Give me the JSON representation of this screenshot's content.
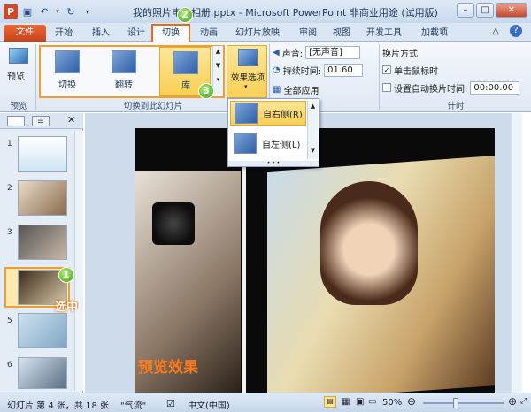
{
  "window": {
    "title": "我的照片电子相册.pptx - Microsoft PowerPoint 非商业用途 (试用版)",
    "controls": [
      "–",
      "□",
      "✕"
    ]
  },
  "tabs": [
    "文件",
    "开始",
    "插入",
    "设计",
    "切换",
    "动画",
    "幻灯片放映",
    "审阅",
    "视图",
    "开发工具",
    "加载项"
  ],
  "ribbon": {
    "preview_label": "预览",
    "preview_group": "预览",
    "gallery": [
      {
        "label": "切换"
      },
      {
        "label": "翻转"
      },
      {
        "label": "库"
      }
    ],
    "effect_options_label": "效果选项",
    "gallery_group": "切换到此幻灯片",
    "sound_label": "声音:",
    "sound_value": "[无声音]",
    "duration_label": "持续时间:",
    "duration_value": "01.60",
    "apply_all_label": "全部应用",
    "advance_label": "换片方式",
    "on_click_label": "单击鼠标时",
    "after_label": "设置自动换片时间:",
    "after_value": "00:00.00",
    "timing_group": "计时"
  },
  "dropdown": {
    "items": [
      "自右侧(R)",
      "自左侧(L)"
    ]
  },
  "slides_pane": {
    "numbers": [
      "1",
      "2",
      "3",
      "4",
      "5",
      "6"
    ],
    "selected_label": "选中"
  },
  "slide": {
    "caption": "预览效果",
    "caption_color": "#ff7a1a"
  },
  "annotations": {
    "step1": "1",
    "step2": "2",
    "step3": "3"
  },
  "statusbar": {
    "slide_info": "幻灯片 第 4 张，共 18 张",
    "theme": "\"气流\"",
    "language": "中文(中国)",
    "zoom": "50%"
  }
}
